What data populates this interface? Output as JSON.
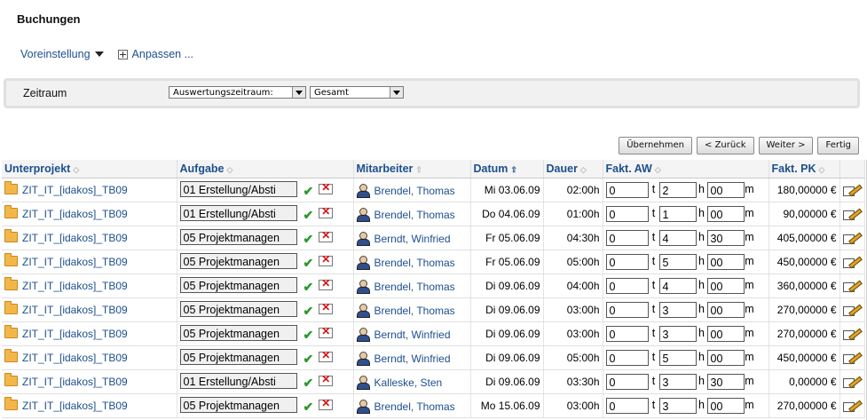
{
  "page": {
    "title": "Buchungen"
  },
  "toolbar": {
    "preset_label": "Voreinstellung",
    "customize_label": "Anpassen ..."
  },
  "filter": {
    "label": "Zeitraum",
    "period_type": "Auswertungszeitraum:",
    "period_value": "Gesamt"
  },
  "buttons": {
    "apply": "Übernehmen",
    "back": "< Zurück",
    "next": "Weiter >",
    "done": "Fertig"
  },
  "table": {
    "headers": {
      "unterprojekt": "Unterprojekt",
      "aufgabe": "Aufgabe",
      "mitarbeiter": "Mitarbeiter",
      "datum": "Datum",
      "dauer": "Dauer",
      "fakt_aw": "Fakt. AW",
      "fakt_pk": "Fakt. PK"
    },
    "unit_labels": {
      "days": "t",
      "hours": "h",
      "minutes": "m"
    },
    "rows": [
      {
        "unterprojekt": "ZIT_IT_[idakos]_TB09",
        "aufgabe": "01 Erstellung/Absti",
        "mitarbeiter": "Brendel, Thomas",
        "datum": "Mi 03.06.09",
        "dauer": "02:00h",
        "t": "0",
        "h": "2",
        "m": "00",
        "pk": "180,00000 €"
      },
      {
        "unterprojekt": "ZIT_IT_[idakos]_TB09",
        "aufgabe": "01 Erstellung/Absti",
        "mitarbeiter": "Brendel, Thomas",
        "datum": "Do 04.06.09",
        "dauer": "01:00h",
        "t": "0",
        "h": "1",
        "m": "00",
        "pk": "90,00000 €"
      },
      {
        "unterprojekt": "ZIT_IT_[idakos]_TB09",
        "aufgabe": "05 Projektmanagen",
        "mitarbeiter": "Berndt, Winfried",
        "datum": "Fr 05.06.09",
        "dauer": "04:30h",
        "t": "0",
        "h": "4",
        "m": "30",
        "pk": "405,00000 €"
      },
      {
        "unterprojekt": "ZIT_IT_[idakos]_TB09",
        "aufgabe": "05 Projektmanagen",
        "mitarbeiter": "Brendel, Thomas",
        "datum": "Fr 05.06.09",
        "dauer": "05:00h",
        "t": "0",
        "h": "5",
        "m": "00",
        "pk": "450,00000 €"
      },
      {
        "unterprojekt": "ZIT_IT_[idakos]_TB09",
        "aufgabe": "05 Projektmanagen",
        "mitarbeiter": "Brendel, Thomas",
        "datum": "Di 09.06.09",
        "dauer": "04:00h",
        "t": "0",
        "h": "4",
        "m": "00",
        "pk": "360,00000 €"
      },
      {
        "unterprojekt": "ZIT_IT_[idakos]_TB09",
        "aufgabe": "05 Projektmanagen",
        "mitarbeiter": "Brendel, Thomas",
        "datum": "Di 09.06.09",
        "dauer": "03:00h",
        "t": "0",
        "h": "3",
        "m": "00",
        "pk": "270,00000 €"
      },
      {
        "unterprojekt": "ZIT_IT_[idakos]_TB09",
        "aufgabe": "05 Projektmanagen",
        "mitarbeiter": "Berndt, Winfried",
        "datum": "Di 09.06.09",
        "dauer": "03:00h",
        "t": "0",
        "h": "3",
        "m": "00",
        "pk": "270,00000 €"
      },
      {
        "unterprojekt": "ZIT_IT_[idakos]_TB09",
        "aufgabe": "05 Projektmanagen",
        "mitarbeiter": "Berndt, Winfried",
        "datum": "Di 09.06.09",
        "dauer": "05:00h",
        "t": "0",
        "h": "5",
        "m": "00",
        "pk": "450,00000 €"
      },
      {
        "unterprojekt": "ZIT_IT_[idakos]_TB09",
        "aufgabe": "01 Erstellung/Absti",
        "mitarbeiter": "Kalleske, Sten",
        "datum": "Di 09.06.09",
        "dauer": "03:30h",
        "t": "0",
        "h": "3",
        "m": "30",
        "pk": "0,00000 €"
      },
      {
        "unterprojekt": "ZIT_IT_[idakos]_TB09",
        "aufgabe": "05 Projektmanagen",
        "mitarbeiter": "Brendel, Thomas",
        "datum": "Mo 15.06.09",
        "dauer": "03:00h",
        "t": "0",
        "h": "3",
        "m": "00",
        "pk": "270,00000 €"
      }
    ]
  }
}
